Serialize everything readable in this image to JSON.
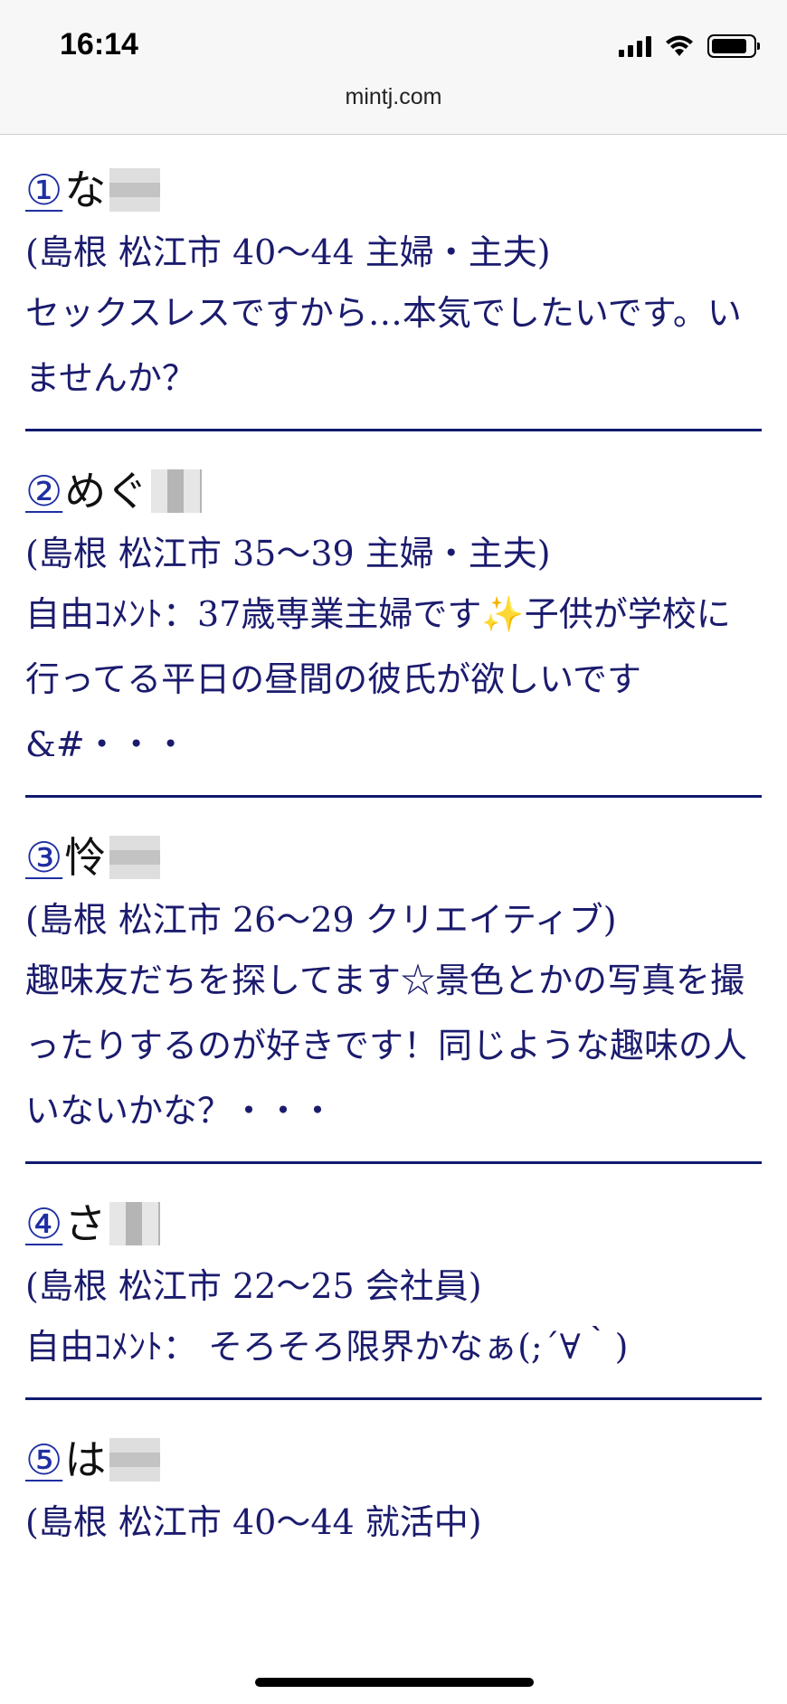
{
  "status_bar": {
    "time": "16:14",
    "icons": [
      "cellular-signal-icon",
      "wifi-icon",
      "battery-icon"
    ]
  },
  "browser": {
    "url": "mintj.com"
  },
  "colors": {
    "text": "#1b1b6e",
    "number_link": "#1f2fa2",
    "separator": "#0f1a6e"
  },
  "entries": [
    {
      "num": "①",
      "name": "な",
      "meta": "(島根 松江市 40〜44 主婦・主夫)",
      "comment": "セックスレスですから…本気でしたいです。いませんか？"
    },
    {
      "num": "②",
      "name": "めぐ",
      "meta": "(島根 松江市 35〜39 主婦・主夫)",
      "comment_before": "自由ｺﾒﾝﾄ：37歳専業主婦です",
      "comment_emoji": "✨",
      "comment_after": "子供が学校に行ってる平日の昼間の彼氏が欲しいです&#・・・"
    },
    {
      "num": "③",
      "name": "怜",
      "meta": "(島根 松江市 26〜29 クリエイティブ)",
      "comment": "趣味友だちを探してます☆景色とかの写真を撮ったりするのが好きです！同じような趣味の人いないかな？・・・"
    },
    {
      "num": "④",
      "name": "さ",
      "meta": "(島根 松江市 22〜25 会社員)",
      "comment": "自由ｺﾒﾝﾄ： そろそろ限界かなぁ(;´∀｀)"
    },
    {
      "num": "⑤",
      "name": "は",
      "meta": "(島根 松江市 40〜44 就活中)"
    }
  ]
}
